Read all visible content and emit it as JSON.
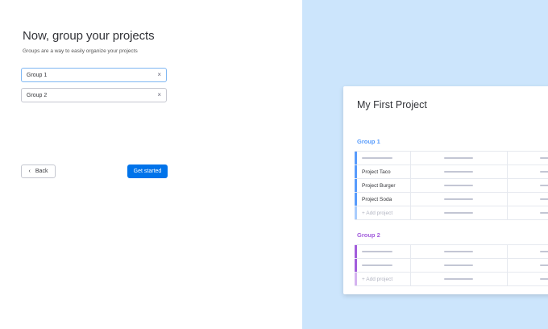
{
  "left": {
    "title": "Now, group your projects",
    "subtitle": "Groups are a way to easily organize your projects",
    "fields": [
      {
        "value": "Group 1",
        "clear": "×"
      },
      {
        "value": "Group 2",
        "clear": "×"
      }
    ],
    "back_label": "Back",
    "back_icon": "‹",
    "primary_label": "Get started"
  },
  "preview": {
    "title": "My First Project",
    "groups": [
      {
        "name": "Group 1",
        "color": "#579bfc",
        "items": [
          "Project Taco",
          "Project Burger",
          "Project Soda"
        ],
        "add_label": "+ Add project"
      },
      {
        "name": "Group 2",
        "color": "#a25ddc",
        "add_label": "+ Add project"
      }
    ]
  },
  "colors": {
    "accent": "#0073ea",
    "panel_bg": "#cce5fc"
  }
}
